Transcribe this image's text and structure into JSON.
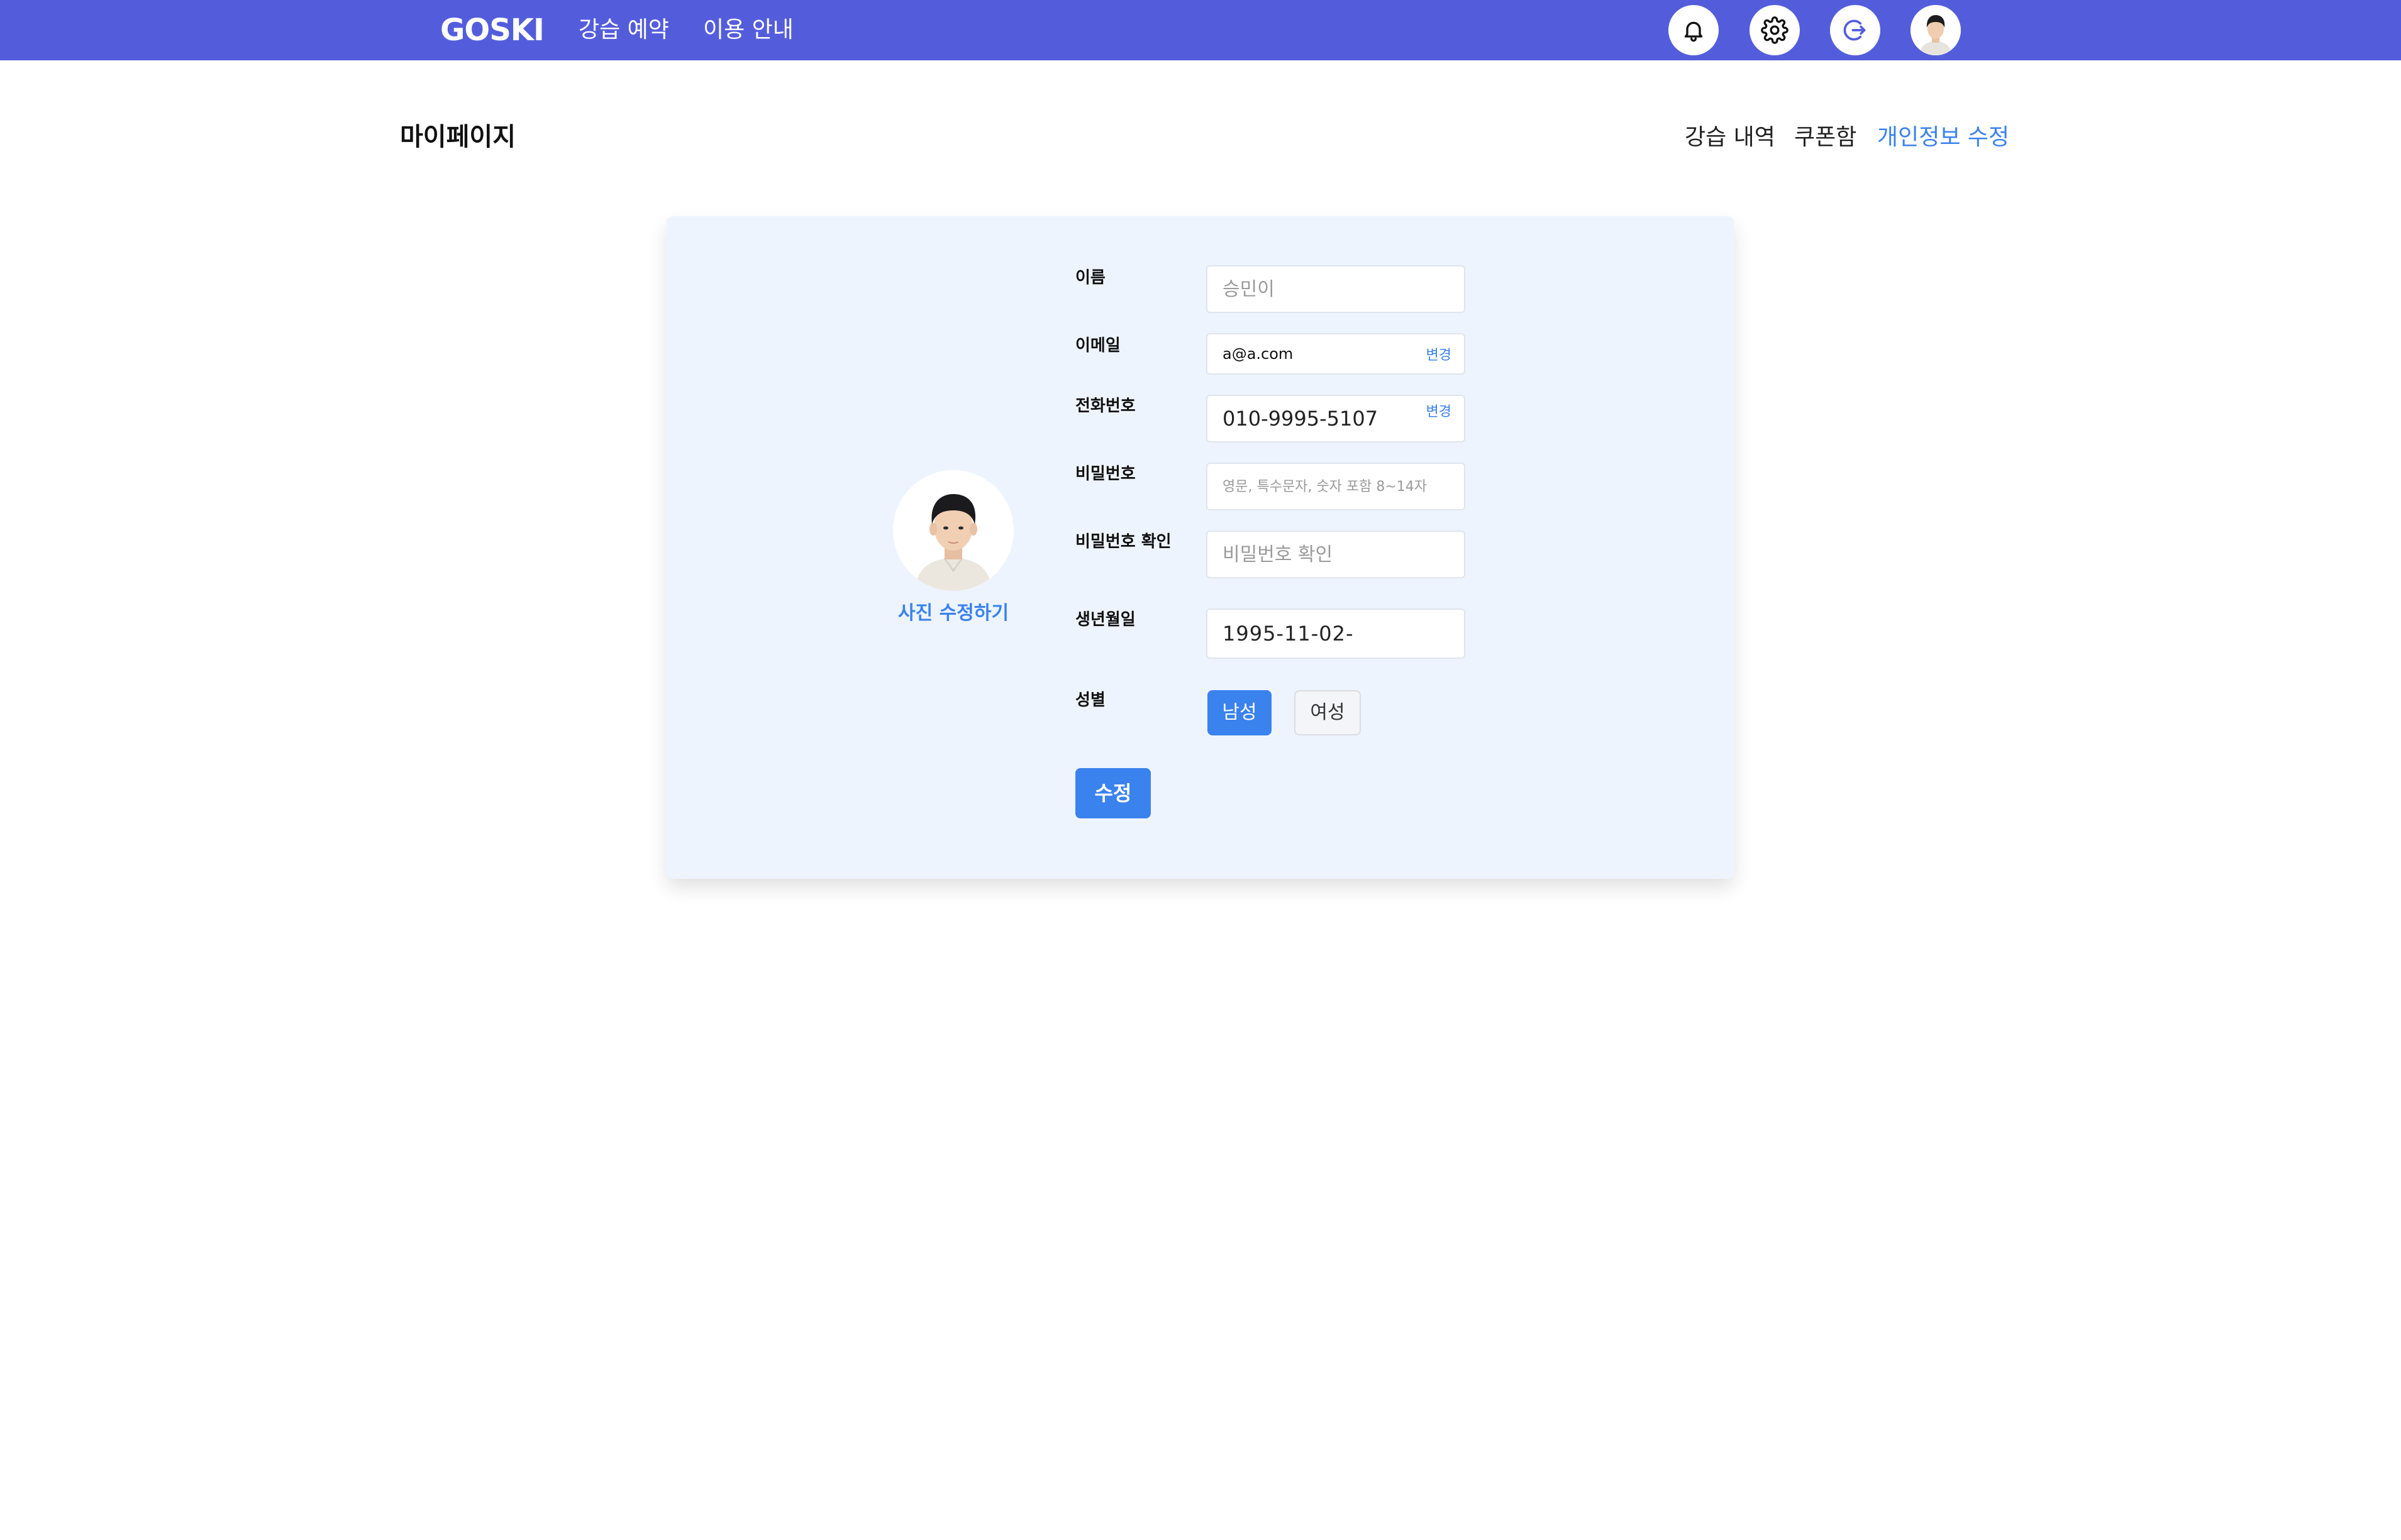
{
  "header": {
    "logo": "GOSKI",
    "nav": {
      "reserve": "강습 예약",
      "guide": "이용 안내"
    },
    "icons": [
      "bell-icon",
      "gear-icon",
      "logout-icon",
      "user-avatar"
    ],
    "brand_color": "#535ddc"
  },
  "page": {
    "title": "마이페이지",
    "tabs": {
      "history": "강습 내역",
      "coupon": "쿠폰함",
      "profile": "개인정보 수정"
    },
    "active_tab": "개인정보 수정"
  },
  "profile": {
    "photo_edit": "사진 수정하기",
    "fields": {
      "name": {
        "label": "이름",
        "value": "",
        "placeholder": "승민이"
      },
      "email": {
        "label": "이메일",
        "value": "a@a.com",
        "action": "변경"
      },
      "phone": {
        "label": "전화번호",
        "value": "010-9995-5107",
        "action": "변경"
      },
      "password": {
        "label": "비밀번호",
        "value": "",
        "placeholder": "영문, 특수문자, 숫자 포함 8~14자"
      },
      "password_confirm": {
        "label": "비밀번호 확인",
        "value": "",
        "placeholder": "비밀번호 확인"
      },
      "birth": {
        "label": "생년월일",
        "value": "1995-11-02-"
      },
      "gender": {
        "label": "성별",
        "options": [
          "남성",
          "여성"
        ],
        "selected": "남성"
      }
    },
    "submit": "수정",
    "accent_color": "#3a82ee"
  }
}
